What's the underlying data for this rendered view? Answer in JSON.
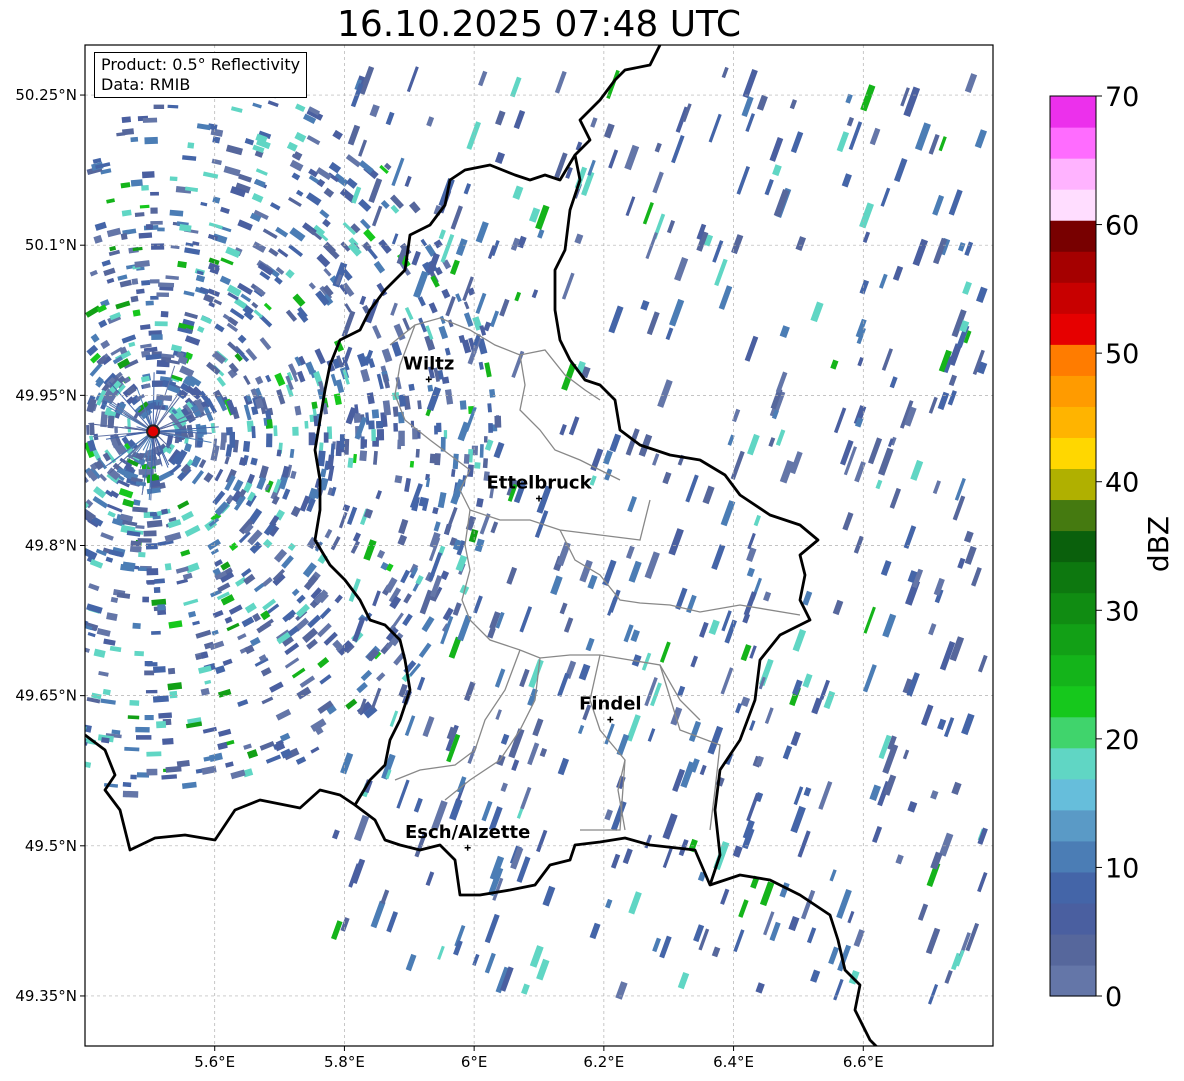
{
  "title": "16.10.2025 07:48 UTC",
  "info": {
    "product": "Product: 0.5° Reflectivity",
    "data": "Data: RMIB"
  },
  "map": {
    "lon_range": [
      5.4,
      6.8
    ],
    "lat_range": [
      49.3,
      50.3
    ],
    "lon_ticks": [
      {
        "v": 5.6,
        "label": "5.6°E"
      },
      {
        "v": 5.8,
        "label": "5.8°E"
      },
      {
        "v": 6.0,
        "label": "6°E"
      },
      {
        "v": 6.2,
        "label": "6.2°E"
      },
      {
        "v": 6.4,
        "label": "6.4°E"
      },
      {
        "v": 6.6,
        "label": "6.6°E"
      }
    ],
    "lat_ticks": [
      {
        "v": 50.25,
        "label": "50.25°N"
      },
      {
        "v": 50.1,
        "label": "50.1°N"
      },
      {
        "v": 49.95,
        "label": "49.95°N"
      },
      {
        "v": 49.8,
        "label": "49.8°N"
      },
      {
        "v": 49.65,
        "label": "49.65°N"
      },
      {
        "v": 49.5,
        "label": "49.5°N"
      },
      {
        "v": 49.35,
        "label": "49.35°N"
      }
    ],
    "cities": [
      {
        "name": "Wiltz",
        "lon": 5.93,
        "lat": 49.966
      },
      {
        "name": "Ettelbruck",
        "lon": 6.1,
        "lat": 49.847
      },
      {
        "name": "Findel",
        "lon": 6.21,
        "lat": 49.626
      },
      {
        "name": "Esch/Alzette",
        "lon": 5.99,
        "lat": 49.498
      }
    ],
    "radar_site": {
      "lon": 5.505,
      "lat": 49.914
    },
    "grid": true,
    "background": "#ffffff"
  },
  "colorbar": {
    "label": "dBZ",
    "ticks": [
      0,
      10,
      20,
      30,
      40,
      50,
      60,
      70
    ],
    "step": 2.5,
    "colors": [
      "#6476a8",
      "#56679c",
      "#4a5fa0",
      "#4465a8",
      "#4b7db5",
      "#5a9ac6",
      "#66bedb",
      "#60d6c4",
      "#40d46c",
      "#16c81c",
      "#14b41a",
      "#12a016",
      "#108c12",
      "#0d780f",
      "#0a600c",
      "#457a10",
      "#b0b000",
      "#ffd700",
      "#ffb400",
      "#ff9b00",
      "#ff7c00",
      "#e60000",
      "#c80000",
      "#a50000",
      "#780000",
      "#ffddff",
      "#ffb3ff",
      "#ff6cff",
      "#ec30ec"
    ]
  }
}
